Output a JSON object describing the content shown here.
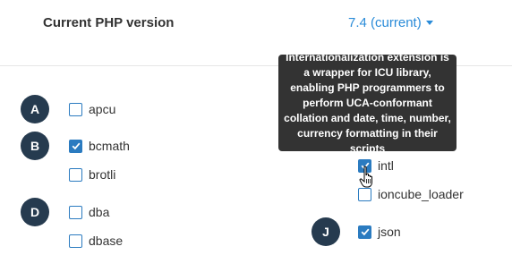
{
  "header": {
    "title": "Current PHP version",
    "version_selected": "7.4 (current)"
  },
  "left_column": {
    "badges": {
      "a": "A",
      "b": "B",
      "d": "D"
    },
    "extensions": [
      {
        "label": "apcu",
        "checked": false
      },
      {
        "label": "bcmath",
        "checked": true
      },
      {
        "label": "brotli",
        "checked": false
      },
      {
        "label": "dba",
        "checked": false
      },
      {
        "label": "dbase",
        "checked": false
      }
    ]
  },
  "right_column": {
    "badges": {
      "j": "J"
    },
    "extensions": [
      {
        "label": "intl",
        "checked": true
      },
      {
        "label": "ioncube_loader",
        "checked": false
      },
      {
        "label": "json",
        "checked": true
      }
    ]
  },
  "tooltip": {
    "text": "Internationalization extension is a wrapper for ICU library, enabling PHP programmers to perform UCA-conformant collation and date, time, number, currency formatting in their scripts"
  },
  "colors": {
    "accent": "#2a8bd8",
    "checkbox": "#2b7bc0",
    "badge": "#263b4f",
    "tooltip_bg": "#333333"
  }
}
